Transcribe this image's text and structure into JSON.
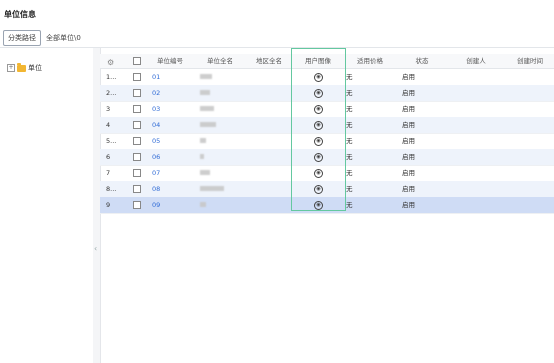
{
  "page": {
    "title": "单位信息"
  },
  "path_bar": {
    "button_label": "分类路径",
    "path_text": "全部单位\\0"
  },
  "tree": {
    "root_label": "单位",
    "expander": "+"
  },
  "grid": {
    "columns": [
      "",
      "",
      "单位编号",
      "单位全名",
      "地区全名",
      "用户图像",
      "适用价格",
      "状态",
      "创建人",
      "创建时间"
    ],
    "rows": [
      {
        "idx": "1...",
        "code": "01",
        "price": "无",
        "status": "启用"
      },
      {
        "idx": "2...",
        "code": "02",
        "price": "无",
        "status": "启用"
      },
      {
        "idx": "3",
        "code": "03",
        "price": "无",
        "status": "启用"
      },
      {
        "idx": "4",
        "code": "04",
        "price": "无",
        "status": "启用"
      },
      {
        "idx": "5...",
        "code": "05",
        "price": "无",
        "status": "启用"
      },
      {
        "idx": "6",
        "code": "06",
        "price": "无",
        "status": "启用"
      },
      {
        "idx": "7",
        "code": "07",
        "price": "无",
        "status": "启用"
      },
      {
        "idx": "8...",
        "code": "08",
        "price": "无",
        "status": "启用"
      },
      {
        "idx": "9",
        "code": "09",
        "price": "无",
        "status": "启用"
      }
    ],
    "selected_row": 9,
    "icons": {
      "settings": "gear-icon",
      "user_image": "user-avatar-icon",
      "collapse": "chevron-left-icon",
      "folder": "folder-icon"
    }
  },
  "colors": {
    "accent": "#2f6bd6",
    "focus": "#64c8a0",
    "selected": "#cfdcf5",
    "alt": "#eef3fb"
  }
}
